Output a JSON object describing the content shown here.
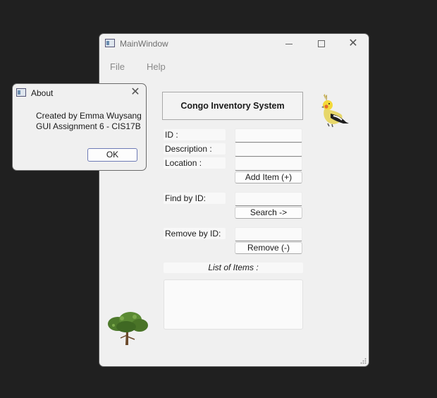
{
  "main_window": {
    "title": "MainWindow",
    "icon": "app-window-icon",
    "controls": {
      "minimize": "minimize-icon",
      "maximize": "maximize-icon",
      "close": "close-icon"
    },
    "menu": [
      "File",
      "Help"
    ],
    "header_title": "Congo Inventory System",
    "labels": {
      "id": "ID :",
      "description": "Description :",
      "location": "Location :",
      "find": "Find by ID:",
      "remove": "Remove by ID:",
      "list": "List of Items :"
    },
    "fields": {
      "id": "",
      "description": "",
      "location": "",
      "find": "",
      "remove": ""
    },
    "buttons": {
      "add": "Add Item (+)",
      "search": "Search ->",
      "remove": "Remove (-)"
    },
    "list_items": [],
    "images": [
      "cockatiel-bird-image",
      "tree-image"
    ]
  },
  "about_dialog": {
    "title": "About",
    "line1": "Created by Emma Wuysang",
    "line2": "GUI Assignment 6 - CIS17B",
    "ok_label": "OK"
  },
  "colors": {
    "desktop": "#202020",
    "window_bg": "#f0f0f0",
    "default_button_border": "#6d7ab5"
  }
}
